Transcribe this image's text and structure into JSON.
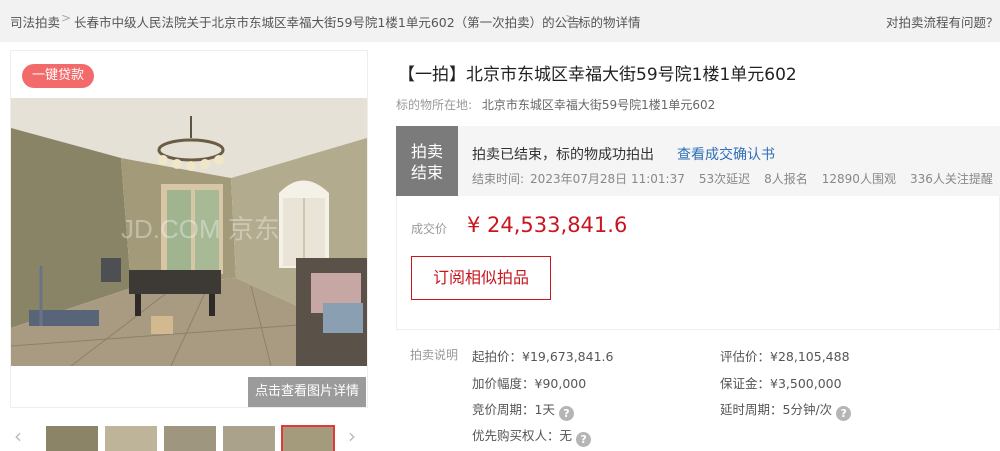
{
  "breadcrumb": {
    "root": "司法拍卖",
    "notice": "长春市中级人民法院关于北京市东城区幸福大街59号院1楼1单元602（第一次拍卖）的公告",
    "current": "标的物详情",
    "separator": ">",
    "help": "对拍卖流程有问题？"
  },
  "gallery": {
    "loan_button": "一键贷款",
    "detail_button": "点击查看图片详情",
    "watermark": "JD.COM 京东",
    "prev_arrow": "‹",
    "next_arrow": "›",
    "thumb_count": 5,
    "active_thumb_index": 4
  },
  "item": {
    "title": "【一拍】北京市东城区幸福大街59号院1楼1单元602",
    "address_label": "标的物所在地:",
    "address_value": "北京市东城区幸福大街59号院1楼1单元602"
  },
  "status": {
    "tag_line1": "拍卖",
    "tag_line2": "结束",
    "text": "拍卖已结束，标的物成功拍出",
    "confirm_link": "查看成交确认书",
    "end_time_label": "结束时间:",
    "end_time": "2023年07月28日 11:01:37",
    "delays": "53次延迟",
    "registrants": "8人报名",
    "watchers": "12890人围观",
    "reminders": "336人关注提醒"
  },
  "price": {
    "label": "成交价",
    "value": "¥ 24,533,841.6",
    "subscribe_button": "订阅相似拍品"
  },
  "notes": {
    "label": "拍卖说明",
    "start_price": "起拍价：¥19,673,841.6",
    "appraisal": "评估价：¥28,105,488",
    "increment": "加价幅度：¥90,000",
    "deposit": "保证金：¥3,500,000",
    "bid_period": "竞价周期：1天",
    "delay_period": "延时周期：5分钟/次",
    "priority": "优先购买权人：无",
    "help_glyph": "?"
  },
  "colors": {
    "accent_red": "#c9151e",
    "loan_pink": "#f26a6a",
    "link_blue": "#2e6fb7",
    "status_gray": "#7b7b7b"
  }
}
